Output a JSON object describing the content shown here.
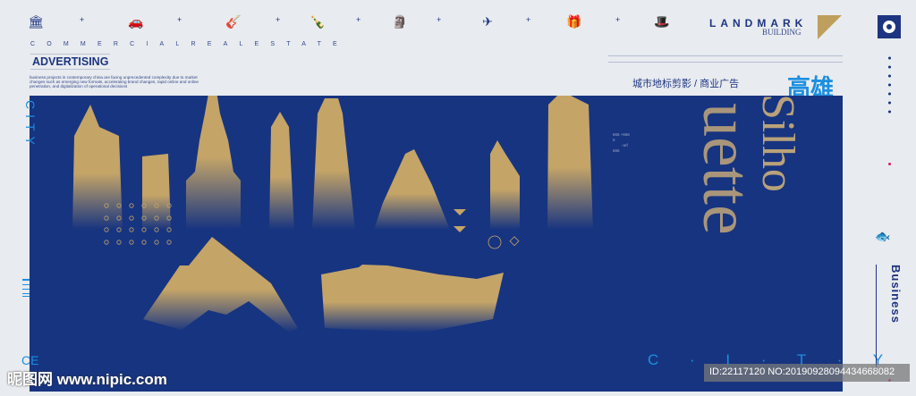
{
  "header": {
    "icons": [
      "bank-icon",
      "car-icon",
      "guitar-icon",
      "bottle-icon",
      "statue-icon",
      "airplane-icon",
      "gift-icon",
      "hat-icon"
    ],
    "brand_title": "LANDMARK",
    "brand_subtitle": "BUILDING"
  },
  "left": {
    "spaced_text": "COMMERCIALREALESTATE",
    "heading": "ADVERTISING",
    "paragraph": "business projects in contemporary china are facing unprecedented complexity due to market changes such as emerging new formats, accelerating brand changes, rapid online and online penetration, and digitalization of operational decisions",
    "vertical_city": "CITY",
    "bottom_letters": "CE"
  },
  "main": {
    "chinese_subtitle": "城市地标剪影 / 商业广告",
    "city_name": "高雄",
    "silho": "Silho",
    "uette": "uette",
    "bottom_city": "C · I · T · Y",
    "small_codes": [
      "666 +666",
      "6",
      "-arf",
      "666"
    ]
  },
  "right": {
    "vertical_heading": "Business"
  },
  "watermark": {
    "site": "昵图网 www.nipic.com",
    "id_text": "ID:22117120 NO:20190928094434668082"
  },
  "colors": {
    "blue": "#173480",
    "gold": "#c4a467",
    "accent": "#1b8fe0"
  }
}
